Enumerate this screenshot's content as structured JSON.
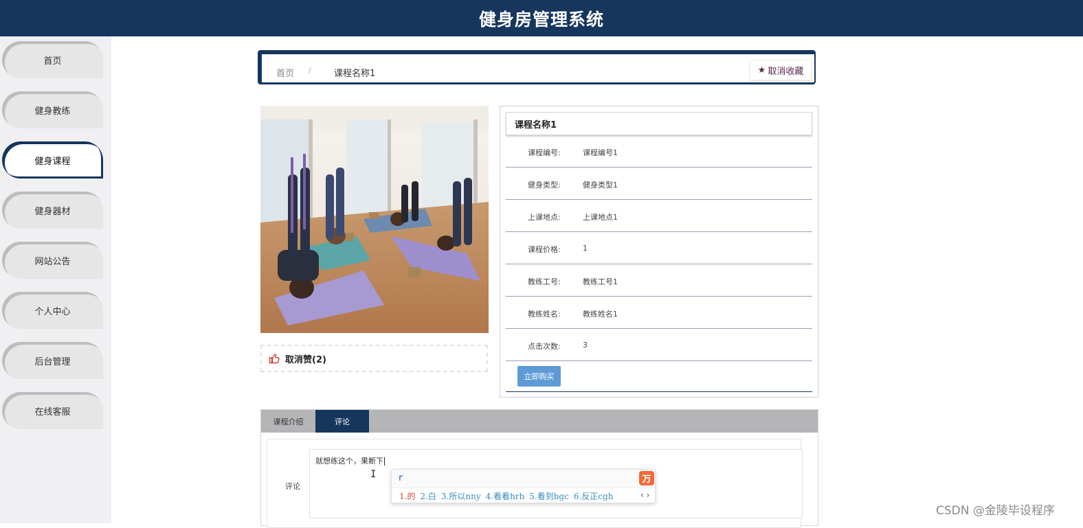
{
  "app": {
    "title": "健身房管理系统"
  },
  "sidebar": {
    "items": [
      {
        "label": "首页",
        "active": false
      },
      {
        "label": "健身教练",
        "active": false
      },
      {
        "label": "健身课程",
        "active": true
      },
      {
        "label": "健身器材",
        "active": false
      },
      {
        "label": "网站公告",
        "active": false
      },
      {
        "label": "个人中心",
        "active": false
      },
      {
        "label": "后台管理",
        "active": false
      },
      {
        "label": "在线客服",
        "active": false
      }
    ]
  },
  "breadcrumb": {
    "home": "首页",
    "separator": "/",
    "current": "课程名称1"
  },
  "favorite": {
    "label": "取消收藏",
    "icon": "star-icon"
  },
  "like": {
    "label": "取消赞(2)",
    "icon": "thumbs-up-icon"
  },
  "course": {
    "title": "课程名称1",
    "fields": [
      {
        "label": "课程编号:",
        "value": "课程编号1"
      },
      {
        "label": "健身类型:",
        "value": "健身类型1"
      },
      {
        "label": "上课地点:",
        "value": "上课地点1"
      },
      {
        "label": "课程价格:",
        "value": "1"
      },
      {
        "label": "教练工号:",
        "value": "教练工号1"
      },
      {
        "label": "教练姓名:",
        "value": "教练姓名1"
      },
      {
        "label": "点击次数:",
        "value": "3"
      }
    ],
    "buy_label": "立即购买"
  },
  "tabs": [
    {
      "label": "课程介绍",
      "active": false
    },
    {
      "label": "评论",
      "active": true
    }
  ],
  "comment": {
    "label": "评论",
    "text": "就想练这个，果断下"
  },
  "ime": {
    "pinyin": "r",
    "logo": "万",
    "candidates": [
      "1.的",
      "2.白",
      "3.所以nny",
      "4.看看hrh",
      "5.看到hgc",
      "6.反正cgh"
    ],
    "nav": "‹ ›"
  },
  "watermark": "CSDN @金陵毕设程序",
  "colors": {
    "primary": "#16365e",
    "buy_button": "#5e9bd6",
    "tab_strip": "#b5b5b7",
    "favorite": "#5a2848"
  }
}
